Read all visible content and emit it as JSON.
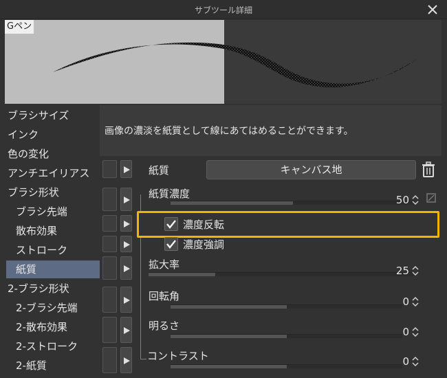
{
  "window": {
    "title": "サブツール詳細"
  },
  "preview": {
    "tag": "Gペン"
  },
  "sidebar": {
    "items": [
      {
        "label": "ブラシサイズ"
      },
      {
        "label": "インク"
      },
      {
        "label": "色の変化"
      },
      {
        "label": "アンチエイリアス"
      },
      {
        "label": "ブラシ形状"
      },
      {
        "label": "ブラシ先端"
      },
      {
        "label": "散布効果"
      },
      {
        "label": "ストローク"
      },
      {
        "label": "紙質"
      },
      {
        "label": "2-ブラシ形状"
      },
      {
        "label": "2-ブラシ先端"
      },
      {
        "label": "2-散布効果"
      },
      {
        "label": "2-ストローク"
      },
      {
        "label": "2-紙質"
      }
    ],
    "selected": "紙質"
  },
  "description": "画像の濃淡を紙質として線にあてはめることができます。",
  "settings": {
    "paper": {
      "label": "紙質",
      "value": "キャンバス地"
    },
    "paper_density": {
      "label": "紙質濃度",
      "value": "50",
      "fill": 0.5
    },
    "invert_density": {
      "label": "濃度反転",
      "checked": true
    },
    "emphasize_density": {
      "label": "濃度強調",
      "checked": true
    },
    "scale": {
      "label": "拡大率",
      "value": "25",
      "fill": 0.25
    },
    "rotation": {
      "label": "回転角",
      "value": "0",
      "fill": 0.5
    },
    "brightness": {
      "label": "明るさ",
      "value": "0",
      "fill": 0.5
    },
    "contrast": {
      "label": "コントラスト",
      "value": "0",
      "fill": 0.5
    }
  },
  "colors": {
    "accent_highlight": "#f5b400",
    "selected_item": "#5e6b85"
  },
  "icons": {
    "close": "close-icon",
    "trash": "trash-icon",
    "arrow": "play-arrow-icon",
    "spin": "spinner-icon",
    "check": "check-icon"
  }
}
